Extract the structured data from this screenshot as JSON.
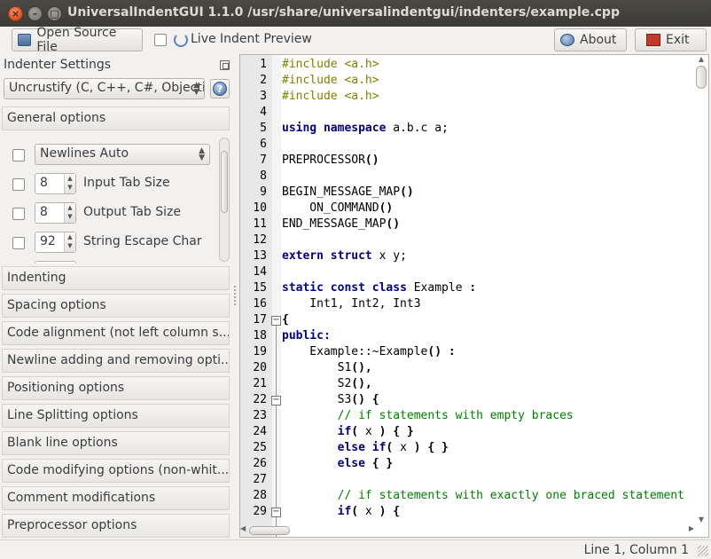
{
  "window": {
    "title": "UniversalIndentGUI 1.1.0 /usr/share/universalindentgui/indenters/example.cpp",
    "close_glyph": "×",
    "min_glyph": "–",
    "max_glyph": "□"
  },
  "toolbar": {
    "open_label": "Open Source File",
    "live_preview_label": "Live Indent Preview",
    "about_label": "About",
    "exit_label": "Exit"
  },
  "left_panel": {
    "title": "Indenter Settings",
    "indenter_selected": "Uncrustify (C, C++, C#, Objecti",
    "help_glyph": "?",
    "sections": [
      "General options",
      "Indenting",
      "Spacing options",
      "Code alignment (not left column s...",
      "Newline adding and removing opti...",
      "Positioning options",
      "Line Splitting options",
      "Blank line options",
      "Code modifying options (non-whit...",
      "Comment modifications",
      "Preprocessor options"
    ],
    "general_options": {
      "newlines_value": "Newlines Auto",
      "rows": [
        {
          "value": "8",
          "label": "Input Tab Size"
        },
        {
          "value": "8",
          "label": "Output Tab Size"
        },
        {
          "value": "92",
          "label": "String Escape Char"
        },
        {
          "value": "",
          "label": ""
        }
      ]
    }
  },
  "editor": {
    "lines": [
      {
        "n": "1",
        "parts": [
          {
            "t": "#include <a.h>",
            "c": "pp"
          }
        ]
      },
      {
        "n": "2",
        "parts": [
          {
            "t": "#include <a.h>",
            "c": "pp"
          }
        ]
      },
      {
        "n": "3",
        "parts": [
          {
            "t": "#include <a.h>",
            "c": "pp"
          }
        ]
      },
      {
        "n": "4",
        "parts": []
      },
      {
        "n": "5",
        "parts": [
          {
            "t": "using",
            "c": "kw"
          },
          {
            "t": " "
          },
          {
            "t": "namespace",
            "c": "kw"
          },
          {
            "t": " a.b.c a;"
          }
        ]
      },
      {
        "n": "6",
        "parts": []
      },
      {
        "n": "7",
        "parts": [
          {
            "t": "PREPROCESSOR"
          },
          {
            "t": "()",
            "c": "op"
          }
        ]
      },
      {
        "n": "8",
        "parts": []
      },
      {
        "n": "9",
        "parts": [
          {
            "t": "BEGIN_MESSAGE_MAP"
          },
          {
            "t": "()",
            "c": "op"
          }
        ]
      },
      {
        "n": "10",
        "parts": [
          {
            "t": "    ON_COMMAND"
          },
          {
            "t": "()",
            "c": "op"
          }
        ]
      },
      {
        "n": "11",
        "parts": [
          {
            "t": "END_MESSAGE_MAP"
          },
          {
            "t": "()",
            "c": "op"
          }
        ]
      },
      {
        "n": "12",
        "parts": []
      },
      {
        "n": "13",
        "parts": [
          {
            "t": "extern",
            "c": "kw"
          },
          {
            "t": " "
          },
          {
            "t": "struct",
            "c": "kw"
          },
          {
            "t": " x y;"
          }
        ]
      },
      {
        "n": "14",
        "parts": []
      },
      {
        "n": "15",
        "parts": [
          {
            "t": "static",
            "c": "kw"
          },
          {
            "t": " "
          },
          {
            "t": "const",
            "c": "kw"
          },
          {
            "t": " "
          },
          {
            "t": "class",
            "c": "kw"
          },
          {
            "t": " Example "
          },
          {
            "t": ":",
            "c": "op"
          }
        ]
      },
      {
        "n": "16",
        "parts": [
          {
            "t": "    Int1, Int2, Int3"
          }
        ]
      },
      {
        "n": "17",
        "parts": [
          {
            "t": "{",
            "c": "op"
          }
        ]
      },
      {
        "n": "18",
        "parts": [
          {
            "t": "public:",
            "c": "kw"
          }
        ]
      },
      {
        "n": "19",
        "parts": [
          {
            "t": "    Example::~Example"
          },
          {
            "t": "()",
            "c": "op"
          },
          {
            "t": " "
          },
          {
            "t": ":",
            "c": "op"
          }
        ]
      },
      {
        "n": "20",
        "parts": [
          {
            "t": "        S1"
          },
          {
            "t": "(),",
            "c": "op"
          }
        ]
      },
      {
        "n": "21",
        "parts": [
          {
            "t": "        S2"
          },
          {
            "t": "(),",
            "c": "op"
          }
        ]
      },
      {
        "n": "22",
        "parts": [
          {
            "t": "        S3"
          },
          {
            "t": "()",
            "c": "op"
          },
          {
            "t": " "
          },
          {
            "t": "{",
            "c": "op"
          }
        ]
      },
      {
        "n": "23",
        "parts": [
          {
            "t": "        // if statements with empty braces",
            "c": "cm"
          }
        ]
      },
      {
        "n": "24",
        "parts": [
          {
            "t": "        "
          },
          {
            "t": "if",
            "c": "kw"
          },
          {
            "t": "(",
            "c": "op"
          },
          {
            "t": " x "
          },
          {
            "t": ")",
            "c": "op"
          },
          {
            "t": " "
          },
          {
            "t": "{ }",
            "c": "op"
          }
        ]
      },
      {
        "n": "25",
        "parts": [
          {
            "t": "        "
          },
          {
            "t": "else",
            "c": "kw"
          },
          {
            "t": " "
          },
          {
            "t": "if",
            "c": "kw"
          },
          {
            "t": "(",
            "c": "op"
          },
          {
            "t": " x "
          },
          {
            "t": ")",
            "c": "op"
          },
          {
            "t": " "
          },
          {
            "t": "{ }",
            "c": "op"
          }
        ]
      },
      {
        "n": "26",
        "parts": [
          {
            "t": "        "
          },
          {
            "t": "else",
            "c": "kw"
          },
          {
            "t": " "
          },
          {
            "t": "{ }",
            "c": "op"
          }
        ]
      },
      {
        "n": "27",
        "parts": []
      },
      {
        "n": "28",
        "parts": [
          {
            "t": "        // if statements with exactly one braced statement",
            "c": "cm"
          }
        ]
      },
      {
        "n": "29",
        "parts": [
          {
            "t": "        "
          },
          {
            "t": "if",
            "c": "kw"
          },
          {
            "t": "(",
            "c": "op"
          },
          {
            "t": " x "
          },
          {
            "t": ")",
            "c": "op"
          },
          {
            "t": " "
          },
          {
            "t": "{",
            "c": "op"
          }
        ]
      }
    ],
    "fold_lines": [
      "17",
      "22",
      "29"
    ]
  },
  "statusbar": {
    "position": "Line 1, Column 1"
  },
  "colors": {
    "preprocessor": "#7f7f00",
    "keyword": "#000080",
    "comment": "#007f00",
    "title_bar": "#3c3b37"
  }
}
